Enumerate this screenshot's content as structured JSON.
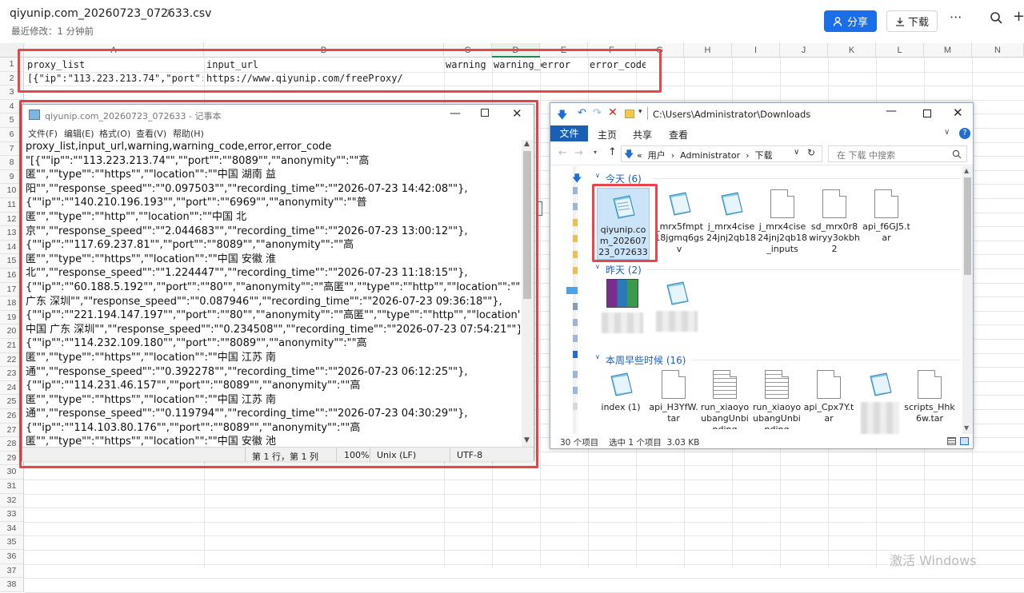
{
  "header": {
    "filename": "qiyunip.com_20260723_072633.csv",
    "modified": "最近修改：1 分钟前",
    "share_label": "分享",
    "download_label": "下载",
    "more_label": "···"
  },
  "sheet": {
    "columns": [
      "A",
      "B",
      "C",
      "D",
      "E",
      "F",
      "G",
      "H",
      "I",
      "J",
      "K",
      "L",
      "M",
      "N"
    ],
    "rows": [
      "1",
      "2",
      "3",
      "4",
      "5",
      "6",
      "7",
      "8",
      "9",
      "10",
      "11",
      "12",
      "13",
      "14",
      "15",
      "16",
      "17",
      "18",
      "19",
      "20",
      "21",
      "22",
      "23",
      "24",
      "25",
      "26",
      "27",
      "28",
      "29",
      "30",
      "31",
      "32",
      "33",
      "34",
      "35",
      "36",
      "37",
      "38"
    ],
    "row1": {
      "a": "proxy_list",
      "b": "input_url",
      "c": "warning",
      "d": "warning_c",
      "e": "error",
      "f": "error_code"
    },
    "row2": {
      "a": "[{\"ip\":\"113.223.213.74\",\"port\":\"8",
      "b": "https://www.qiyunip.com/freeProxy/"
    },
    "watermark": "激活 Windows"
  },
  "notepad": {
    "title": "qiyunip.com_20260723_072633 - 记事本",
    "menu": [
      "文件(F)",
      "编辑(E)",
      "格式(O)",
      "查看(V)",
      "帮助(H)"
    ],
    "lines": [
      "proxy_list,input_url,warning,warning_code,error,error_code",
      "\"[{\"\"ip\"\":\"\"113.223.213.74\"\",\"\"port\"\":\"\"8089\"\",\"\"anonymity\"\":\"\"高",
      "匿\"\",\"\"type\"\":\"\"https\"\",\"\"location\"\":\"\"中国 湖南 益",
      "阳\"\",\"\"response_speed\"\":\"\"0.097503\"\",\"\"recording_time\"\":\"\"2026-07-23 14:42:08\"\"},",
      "{\"\"ip\"\":\"\"140.210.196.193\"\",\"\"port\"\":\"\"6969\"\",\"\"anonymity\"\":\"\"普",
      "匿\"\",\"\"type\"\":\"\"http\"\",\"\"location\"\":\"\"中国 北",
      "京\"\",\"\"response_speed\"\":\"\"2.044683\"\",\"\"recording_time\"\":\"\"2026-07-23 13:00:12\"\"},",
      "{\"\"ip\"\":\"\"117.69.237.81\"\",\"\"port\"\":\"\"8089\"\",\"\"anonymity\"\":\"\"高",
      "匿\"\",\"\"type\"\":\"\"https\"\",\"\"location\"\":\"\"中国 安徽 淮",
      "北\"\",\"\"response_speed\"\":\"\"1.224447\"\",\"\"recording_time\"\":\"\"2026-07-23 11:18:15\"\"},",
      "{\"\"ip\"\":\"\"60.188.5.192\"\",\"\"port\"\":\"\"80\"\",\"\"anonymity\"\":\"\"高匿\"\",\"\"type\"\":\"\"http\"\",\"\"location\"\":\"\"中国",
      "广东 深圳\"\",\"\"response_speed\"\":\"\"0.087946\"\",\"\"recording_time\"\":\"\"2026-07-23 09:36:18\"\"},",
      "{\"\"ip\"\":\"\"221.194.147.197\"\",\"\"port\"\":\"\"80\"\",\"\"anonymity\"\":\"\"高匿\"\",\"\"type\"\":\"\"http\"\",\"\"location\"\":\"\"",
      "中国 广东 深圳\"\",\"\"response_speed\"\":\"\"0.234508\"\",\"\"recording_time\"\":\"\"2026-07-23 07:54:21\"\"},",
      "{\"\"ip\"\":\"\"114.232.109.180\"\",\"\"port\"\":\"\"8089\"\",\"\"anonymity\"\":\"\"高",
      "匿\"\",\"\"type\"\":\"\"https\"\",\"\"location\"\":\"\"中国 江苏 南",
      "通\"\",\"\"response_speed\"\":\"\"0.392278\"\",\"\"recording_time\"\":\"\"2026-07-23 06:12:25\"\"},",
      "{\"\"ip\"\":\"\"114.231.46.157\"\",\"\"port\"\":\"\"8089\"\",\"\"anonymity\"\":\"\"高",
      "匿\"\",\"\"type\"\":\"\"https\"\",\"\"location\"\":\"\"中国 江苏 南",
      "通\"\",\"\"response_speed\"\":\"\"0.119794\"\",\"\"recording_time\"\":\"\"2026-07-23 04:30:29\"\"},",
      "{\"\"ip\"\":\"\"114.103.80.176\"\",\"\"port\"\":\"\"8089\"\",\"\"anonymity\"\":\"\"高",
      "匿\"\",\"\"type\"\":\"\"https\"\",\"\"location\"\":\"\"中国 安徽 池"
    ],
    "status": {
      "position": "第 1 行，第 1 列",
      "zoom": "100%",
      "eol": "Unix (LF)",
      "encoding": "UTF-8"
    }
  },
  "explorer": {
    "path_title": "C:\\Users\\Administrator\\Downloads",
    "ribbon_tabs": [
      "文件",
      "主页",
      "共享",
      "查看"
    ],
    "address": [
      "«",
      "用户",
      "›",
      "Administrator",
      "›",
      "下载"
    ],
    "search_placeholder": "在 下载 中搜索",
    "groups": [
      {
        "label": "今天 (6)"
      },
      {
        "label": "昨天 (2)"
      },
      {
        "label": "本周早些时候 (16)"
      }
    ],
    "today_files": [
      "qiyunip.com_20260723_072633",
      "_mrx5fmpt18jgmq6gsv",
      "j_mrx4cise24jnj2qb18",
      "j_mrx4cise24jnj2qb18_inputs",
      "sd_mrx0r8wiryy3okbh2",
      "api_f6GJ5.tar"
    ],
    "week_files": [
      "index (1)",
      "api_H3YfW.tar",
      "run_xiaoyoubangUnbinding",
      "run_xiaoyoubangUnbinding",
      "api_Cpx7Y.tar",
      "",
      "scripts_Hhk6w.tar"
    ],
    "status_count": "30 个项目",
    "status_selected": "选中 1 个项目  3.03 KB"
  }
}
